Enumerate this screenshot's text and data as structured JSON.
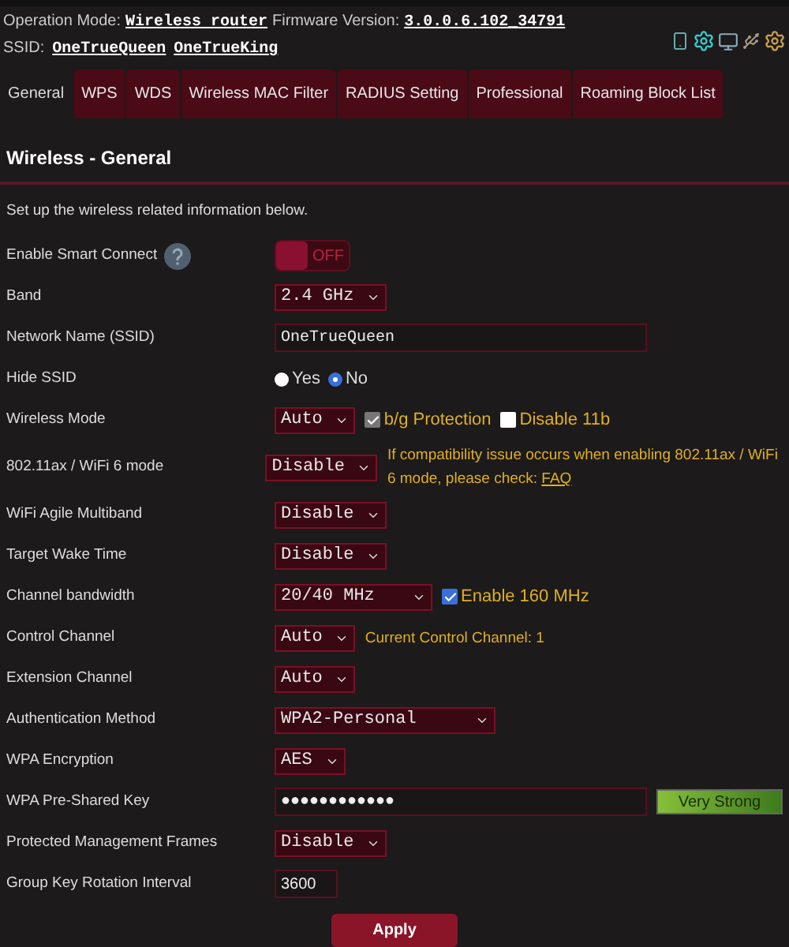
{
  "header": {
    "mode_label": "Operation Mode:",
    "mode_value": "Wireless router",
    "firmware_label": "Firmware Version:",
    "firmware_value": "3.0.0.6.102_34791",
    "ssid_label": "SSID:",
    "ssids": [
      "OneTrueQueen",
      "OneTrueKing"
    ]
  },
  "tabs": [
    {
      "label": "General",
      "selected": true
    },
    {
      "label": "WPS",
      "selected": false
    },
    {
      "label": "WDS",
      "selected": false
    },
    {
      "label": "Wireless MAC Filter",
      "selected": false
    },
    {
      "label": "RADIUS Setting",
      "selected": false
    },
    {
      "label": "Professional",
      "selected": false
    },
    {
      "label": "Roaming Block List",
      "selected": false
    }
  ],
  "title": "Wireless - General",
  "description": "Set up the wireless related information below.",
  "rows": [
    {
      "label": "Enable Smart Connect",
      "help": true,
      "controls": [
        {
          "kind": "toggle",
          "text": "OFF",
          "on": false
        }
      ]
    },
    {
      "label": "Band",
      "controls": [
        {
          "kind": "select",
          "value": "2.4 GHz"
        }
      ]
    },
    {
      "label": "Network Name (SSID)",
      "controls": [
        {
          "kind": "text",
          "value": "OneTrueQueen"
        }
      ]
    },
    {
      "label": "Hide SSID",
      "controls": [
        {
          "kind": "radio",
          "options": [
            {
              "label": "Yes",
              "selected": false
            },
            {
              "label": "No",
              "selected": true
            }
          ]
        }
      ]
    },
    {
      "label": "Wireless Mode",
      "controls": [
        {
          "kind": "select",
          "value": "Auto"
        },
        {
          "kind": "checkbox",
          "label": "b/g Protection",
          "checked": true,
          "disabled": true
        },
        {
          "kind": "checkbox",
          "label": "Disable 11b",
          "checked": false,
          "disabled": false
        }
      ]
    },
    {
      "label": "802.11ax / WiFi 6 mode",
      "controls": [
        {
          "kind": "select",
          "value": "Disable"
        },
        {
          "kind": "note",
          "text": "If compatibility issue occurs when enabling 802.11ax / WiFi 6 mode, please check:",
          "link": "FAQ"
        }
      ]
    },
    {
      "label": "WiFi Agile Multiband",
      "controls": [
        {
          "kind": "select",
          "value": "Disable"
        }
      ]
    },
    {
      "label": "Target Wake Time",
      "controls": [
        {
          "kind": "select",
          "value": "Disable"
        }
      ]
    },
    {
      "label": "Channel bandwidth",
      "controls": [
        {
          "kind": "select",
          "value": "20/40 MHz"
        },
        {
          "kind": "checkbox",
          "label": "Enable 160 MHz",
          "checked": true,
          "disabled": false
        }
      ]
    },
    {
      "label": "Control Channel",
      "controls": [
        {
          "kind": "select",
          "value": "Auto"
        },
        {
          "kind": "note",
          "text": "Current Control Channel: 1"
        }
      ]
    },
    {
      "label": "Extension Channel",
      "controls": [
        {
          "kind": "select",
          "value": "Auto"
        }
      ]
    },
    {
      "label": "Authentication Method",
      "controls": [
        {
          "kind": "select",
          "value": "WPA2-Personal"
        }
      ]
    },
    {
      "label": "WPA Encryption",
      "controls": [
        {
          "kind": "select",
          "value": "AES"
        }
      ]
    },
    {
      "label": "WPA Pre-Shared Key",
      "controls": [
        {
          "kind": "password",
          "value": "●●●●●●●●●●●●"
        },
        {
          "kind": "strength",
          "text": "Very Strong",
          "level": 1
        }
      ]
    },
    {
      "label": "Protected Management Frames",
      "controls": [
        {
          "kind": "select",
          "value": "Disable"
        }
      ]
    },
    {
      "label": "Group Key Rotation Interval",
      "controls": [
        {
          "kind": "short-text",
          "value": "3600"
        }
      ]
    }
  ],
  "apply_button": "Apply"
}
